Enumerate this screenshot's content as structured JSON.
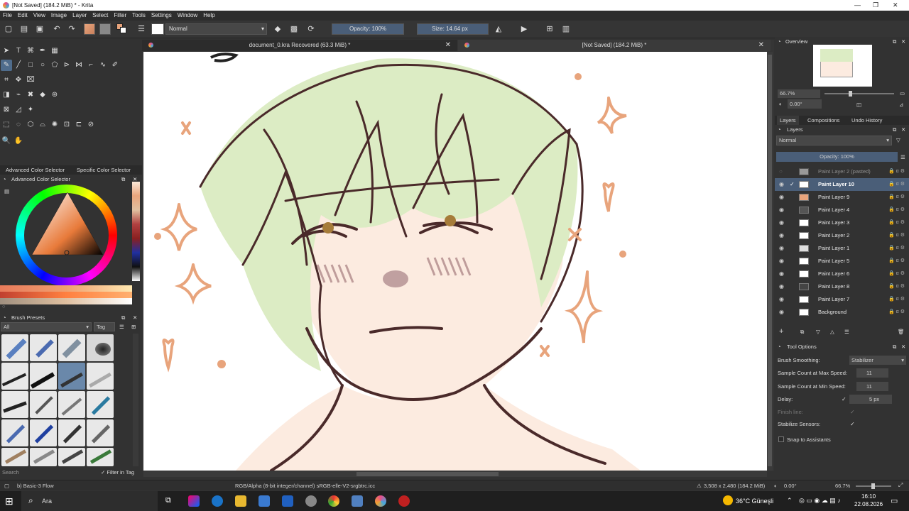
{
  "window": {
    "title": "[Not Saved] (184.2 MiB) * - Krita"
  },
  "menu": [
    "File",
    "Edit",
    "View",
    "Image",
    "Layer",
    "Select",
    "Filter",
    "Tools",
    "Settings",
    "Window",
    "Help"
  ],
  "toolbar": {
    "blend_mode": "Normal",
    "opacity": "Opacity: 100%",
    "size": "Size: 14.64 px"
  },
  "doc_tabs": [
    "document_0.kra Recovered (63.3 MiB) *",
    "[Not Saved]  (184.2 MiB) *"
  ],
  "color_panel": {
    "tabs": [
      "Advanced Color Selector",
      "Specific Color Selector"
    ],
    "title": "Advanced Color Selector"
  },
  "presets": {
    "title": "Brush Presets",
    "filter": "All",
    "tag": "Tag",
    "search_placeholder": "Search",
    "filter_in_tag": "Filter in Tag"
  },
  "overview": {
    "title": "Overview",
    "zoom": "66.7%",
    "rotation": "0.00°"
  },
  "layers_panel": {
    "tabs": [
      "Layers",
      "Compositions",
      "Undo History"
    ],
    "title": "Layers",
    "blend": "Normal",
    "opacity": "Opacity: 100%",
    "items": [
      {
        "name": "Paint Layer 2 (pasted)",
        "visible": false,
        "selected": false
      },
      {
        "name": "Paint Layer 10",
        "visible": true,
        "selected": true
      },
      {
        "name": "Paint Layer 9",
        "visible": true,
        "selected": false
      },
      {
        "name": "Paint Layer 4",
        "visible": true,
        "selected": false
      },
      {
        "name": "Paint Layer 3",
        "visible": true,
        "selected": false
      },
      {
        "name": "Paint Layer 2",
        "visible": true,
        "selected": false
      },
      {
        "name": "Paint Layer 1",
        "visible": true,
        "selected": false
      },
      {
        "name": "Paint Layer 5",
        "visible": true,
        "selected": false
      },
      {
        "name": "Paint Layer 6",
        "visible": true,
        "selected": false
      },
      {
        "name": "Paint Layer 8",
        "visible": true,
        "selected": false
      },
      {
        "name": "Paint Layer 7",
        "visible": true,
        "selected": false
      },
      {
        "name": "Background",
        "visible": true,
        "selected": false
      }
    ]
  },
  "tool_options": {
    "title": "Tool Options",
    "brush_smoothing_label": "Brush Smoothing:",
    "brush_smoothing_value": "Stabilizer",
    "max_speed_label": "Sample Count at Max Speed:",
    "max_speed_value": "11",
    "min_speed_label": "Sample Count at Min Speed:",
    "min_speed_value": "11",
    "delay_label": "Delay:",
    "delay_value": "5 px",
    "finish_line_label": "Finish line:",
    "stabilize_label": "Stabilize Sensors:",
    "snap_label": "Snap to Assistants"
  },
  "status": {
    "preset": "b) Basic-3 Flow",
    "color_space": "RGB/Alpha (8-bit integer/channel)  sRGB-elle-V2-srgbtrc.icc",
    "dimensions": "3,508 x 2,480 (184.2 MiB)",
    "rotation": "0.00°",
    "zoom": "66.7%"
  },
  "taskbar": {
    "search": "Ara",
    "weather": "36°C  Güneşli",
    "time": "16:10",
    "date": "22.08.2026"
  },
  "colors": {
    "accent": "#4a5e78",
    "sketch": "#e8a47c",
    "hair": "#d9ecc0",
    "line": "#4a2a2a"
  }
}
